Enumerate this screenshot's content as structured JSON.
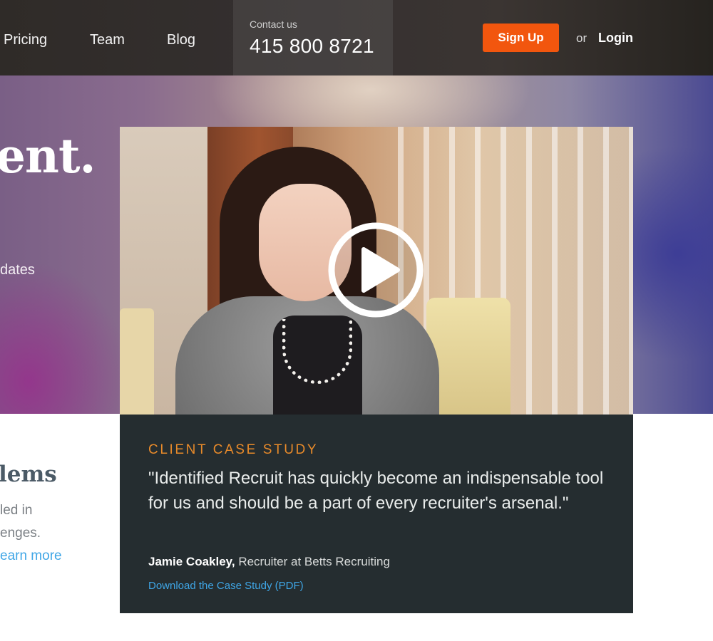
{
  "nav": {
    "links": [
      "Pricing",
      "Team",
      "Blog"
    ],
    "contact_label": "Contact us",
    "contact_phone": "415 800 8721",
    "signup_label": "Sign Up",
    "or_text": "or",
    "login_label": "Login"
  },
  "hero": {
    "headline_partial": "ent.",
    "subtext_partial": "dates"
  },
  "video": {
    "play_icon": "play-circle-icon"
  },
  "case_study": {
    "label": "CLIENT CASE STUDY",
    "quote": "\"Identified Recruit has quickly become an indispensable tool for us and should be a part of every recruiter's arsenal.\"",
    "author_name": "Jamie Coakley,",
    "author_role": "Recruiter at Betts Recruiting",
    "download_link": "Download the Case Study (PDF)"
  },
  "left_section": {
    "heading_partial": "lems",
    "lines": [
      "led in",
      "enges."
    ],
    "learn_more_partial": "earn more"
  },
  "colors": {
    "accent_orange": "#f2560e",
    "case_label_orange": "#e88a2a",
    "link_blue": "#3fa6e6",
    "case_bg": "#252d30"
  }
}
